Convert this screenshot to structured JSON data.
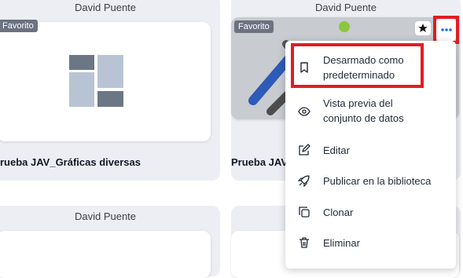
{
  "cards": [
    {
      "owner": "David Puente",
      "badge": "Favorito",
      "title": "rueba JAV_Gráficas diversas"
    },
    {
      "owner": "David Puente",
      "badge": "Favorito",
      "title": "Prueba JAV"
    },
    {
      "owner": "David Puente"
    }
  ],
  "menu": {
    "items": [
      {
        "icon": "bookmark-icon",
        "label": "Desarmado como\npredeterminado"
      },
      {
        "icon": "eye-icon",
        "label": "Vista previa del\nconjunto de datos"
      },
      {
        "icon": "edit-icon",
        "label": "Editar"
      },
      {
        "icon": "rocket-icon",
        "label": "Publicar en la biblioteca"
      },
      {
        "icon": "copy-icon",
        "label": "Clonar"
      },
      {
        "icon": "trash-icon",
        "label": "Eliminar"
      }
    ]
  },
  "colors": {
    "highlight": "#e31b23",
    "accent": "#1d6ff2"
  }
}
